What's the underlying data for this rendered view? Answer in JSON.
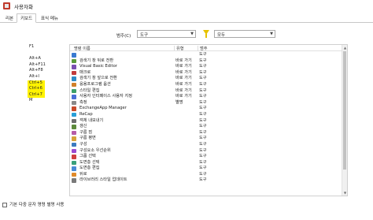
{
  "window": {
    "title": "사용자화"
  },
  "tabs": [
    {
      "label": "리본"
    },
    {
      "label": "키보드"
    },
    {
      "label": "표식 메뉴"
    }
  ],
  "filter": {
    "category_label": "범주(C)",
    "category_value": "도구",
    "all_value": "모두"
  },
  "shortcuts": [
    {
      "key": "F1",
      "highlighted": false
    },
    {
      "key": "",
      "highlighted": false
    },
    {
      "key": "Alt+A",
      "highlighted": false
    },
    {
      "key": "Alt+F11",
      "highlighted": false
    },
    {
      "key": "Alt+F8",
      "highlighted": false
    },
    {
      "key": "Alt+I",
      "highlighted": false
    },
    {
      "key": "Ctrl+5",
      "highlighted": true
    },
    {
      "key": "Ctrl+6",
      "highlighted": true
    },
    {
      "key": "Ctrl+7",
      "highlighted": true
    },
    {
      "key": "M",
      "highlighted": false
    }
  ],
  "grid": {
    "headers": {
      "name": "명령 이름",
      "type": "유형",
      "scope": "범주"
    },
    "rows": [
      {
        "icon_color": "#3a7ad1",
        "name": "",
        "type": "",
        "scope": "도구"
      },
      {
        "icon_color": "#5a9a3a",
        "name": "검색기 창 뒤로 전환",
        "type": "바로 가기",
        "scope": "도구"
      },
      {
        "icon_color": "#7b4fb0",
        "name": "Visual Basic Editor",
        "type": "바로 가기",
        "scope": "도구"
      },
      {
        "icon_color": "#c23a3a",
        "name": "매크로",
        "type": "바로 가기",
        "scope": "도구"
      },
      {
        "icon_color": "#2f8bc6",
        "name": "검색기 창 앞으로 전환",
        "type": "바로 가기",
        "scope": "도구"
      },
      {
        "icon_color": "#d0802a",
        "name": "응용프로그램 옵션",
        "type": "바로 가기",
        "scope": "도구"
      },
      {
        "icon_color": "#3c9f6a",
        "name": "스타일 편집",
        "type": "바로 가기",
        "scope": "도구"
      },
      {
        "icon_color": "#4a6fd6",
        "name": "사용자 인터페이스 사용자 지정",
        "type": "바로 가기",
        "scope": "도구"
      },
      {
        "icon_color": "#8a8a8a",
        "name": "측정",
        "type": "별명",
        "scope": "도구"
      },
      {
        "icon_color": "#c94b2b",
        "name": "ExchangeApp Manager",
        "type": "",
        "scope": "도구"
      },
      {
        "icon_color": "#2a9fd8",
        "name": "ReCap",
        "type": "",
        "scope": "도구"
      },
      {
        "icon_color": "#6d6d6d",
        "name": "객체 내보내기",
        "type": "",
        "scope": "도구"
      },
      {
        "icon_color": "#5d8a3c",
        "name": "갱신",
        "type": "",
        "scope": "도구"
      },
      {
        "icon_color": "#b65ca8",
        "name": "구름 점",
        "type": "",
        "scope": "도구"
      },
      {
        "icon_color": "#d7a23b",
        "name": "구름 평면",
        "type": "",
        "scope": "도구"
      },
      {
        "icon_color": "#3b7bbf",
        "name": "구성",
        "type": "",
        "scope": "도구"
      },
      {
        "icon_color": "#9a4ad0",
        "name": "구성요소 우선순위",
        "type": "",
        "scope": "도구"
      },
      {
        "icon_color": "#cf4040",
        "name": "그룹 선택",
        "type": "",
        "scope": "도구"
      },
      {
        "icon_color": "#3aa07a",
        "name": "도면층 선택",
        "type": "",
        "scope": "도구"
      },
      {
        "icon_color": "#4a8ad6",
        "name": "도면층 편집",
        "type": "",
        "scope": "도구"
      },
      {
        "icon_color": "#e08a2a",
        "name": "뒤로",
        "type": "",
        "scope": "도구"
      },
      {
        "icon_color": "#7a7a7a",
        "name": "라이브러리 스타일 업데이트",
        "type": "",
        "scope": "도구"
      }
    ]
  },
  "footer": {
    "checkbox_label": "기본 다중 문자 명령 별명 사용"
  }
}
